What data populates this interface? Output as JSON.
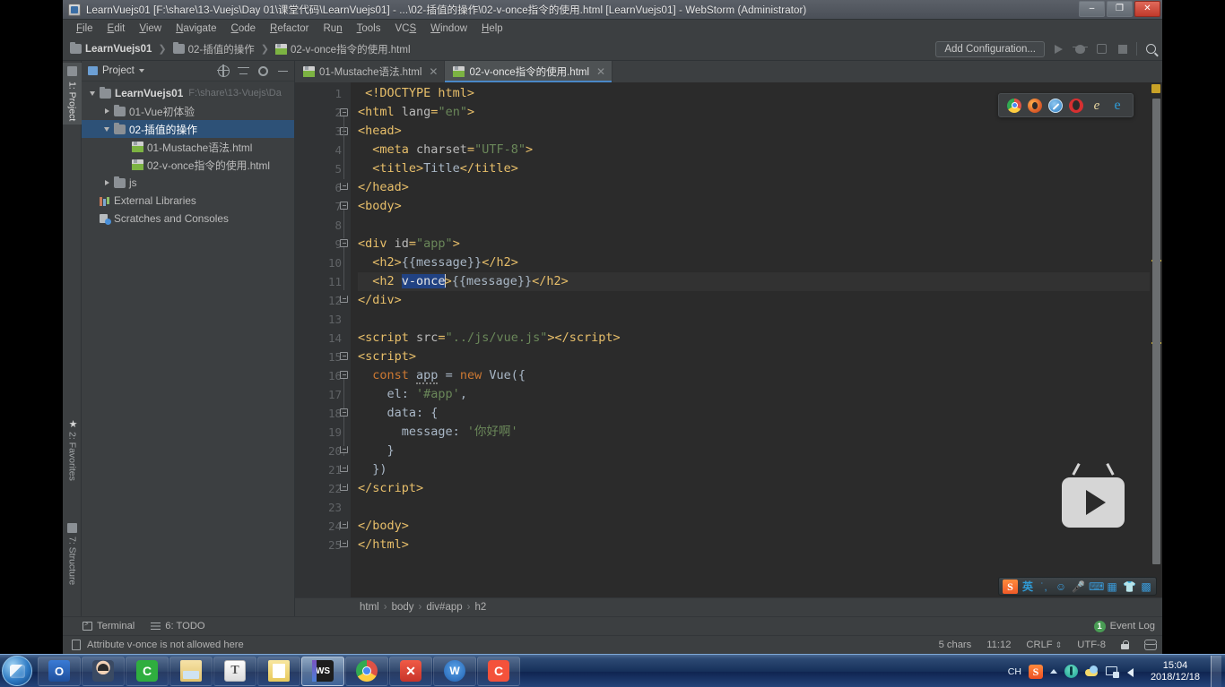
{
  "window": {
    "title": "LearnVuejs01 [F:\\share\\13-Vuejs\\Day 01\\课堂代码\\LearnVuejs01] - ...\\02-插值的操作\\02-v-once指令的使用.html [LearnVuejs01] - WebStorm (Administrator)",
    "icon": "webstorm-icon",
    "minimize": "–",
    "maximize": "❐",
    "close": "✕"
  },
  "menubar": {
    "items": [
      {
        "label": "File"
      },
      {
        "label": "Edit"
      },
      {
        "label": "View"
      },
      {
        "label": "Navigate"
      },
      {
        "label": "Code"
      },
      {
        "label": "Refactor"
      },
      {
        "label": "Run"
      },
      {
        "label": "Tools"
      },
      {
        "label": "VCS"
      },
      {
        "label": "Window"
      },
      {
        "label": "Help"
      }
    ]
  },
  "navbar": {
    "breadcrumb": [
      {
        "label": "LearnVuejs01",
        "icon": "folder-icon"
      },
      {
        "label": "02-插值的操作",
        "icon": "folder-icon"
      },
      {
        "label": "02-v-once指令的使用.html",
        "icon": "html-file-icon"
      }
    ],
    "add_configuration": "Add Configuration...",
    "run_icon": "run-icon",
    "debug_icon": "debug-icon",
    "run_with_coverage_icon": "run-with-coverage-icon",
    "stop_icon": "stop-icon",
    "search_icon": "search-icon"
  },
  "left_strip": {
    "project": "1: Project",
    "favorites": "2: Favorites",
    "structure": "7: Structure"
  },
  "project_panel": {
    "title": "Project",
    "header_icons": [
      "target-icon",
      "collapse-all-icon",
      "gear-icon",
      "minimize-icon"
    ],
    "tree": [
      {
        "label": "LearnVuejs01",
        "path": "F:\\share\\13-Vuejs\\Da",
        "indent": 0,
        "arrow": "down",
        "icon": "folder-icon",
        "bold": true,
        "selected": false
      },
      {
        "label": "01-Vue初体验",
        "path": "",
        "indent": 1,
        "arrow": "right",
        "icon": "folder-icon",
        "bold": false,
        "selected": false
      },
      {
        "label": "02-插值的操作",
        "path": "",
        "indent": 1,
        "arrow": "down",
        "icon": "folder-icon",
        "bold": false,
        "selected": true
      },
      {
        "label": "01-Mustache语法.html",
        "path": "",
        "indent": 2,
        "arrow": "none",
        "icon": "html-file-icon",
        "bold": false,
        "selected": false
      },
      {
        "label": "02-v-once指令的使用.html",
        "path": "",
        "indent": 2,
        "arrow": "none",
        "icon": "html-file-icon",
        "bold": false,
        "selected": false
      },
      {
        "label": "js",
        "path": "",
        "indent": 1,
        "arrow": "right",
        "icon": "folder-icon",
        "bold": false,
        "selected": false
      },
      {
        "label": "External Libraries",
        "path": "",
        "indent": 0,
        "arrow": "none",
        "icon": "library-icon",
        "bold": false,
        "selected": false
      },
      {
        "label": "Scratches and Consoles",
        "path": "",
        "indent": 0,
        "arrow": "none",
        "icon": "scratches-icon",
        "bold": false,
        "selected": false
      }
    ]
  },
  "editor": {
    "tabs": [
      {
        "label": "01-Mustache语法.html",
        "icon": "html-file-icon",
        "active": false,
        "close": "✕"
      },
      {
        "label": "02-v-once指令的使用.html",
        "icon": "html-file-icon",
        "active": true,
        "close": "✕"
      }
    ],
    "line_numbers": [
      "1",
      "2",
      "3",
      "4",
      "5",
      "6",
      "7",
      "8",
      "9",
      "10",
      "11",
      "12",
      "13",
      "14",
      "15",
      "16",
      "17",
      "18",
      "19",
      "20",
      "21",
      "22",
      "23",
      "24",
      "25"
    ],
    "lines": [
      {
        "n": 1,
        "text": "<!DOCTYPE html>"
      },
      {
        "n": 2,
        "text": "<html lang=\"en\">"
      },
      {
        "n": 3,
        "text": "<head>"
      },
      {
        "n": 4,
        "text": "  <meta charset=\"UTF-8\">"
      },
      {
        "n": 5,
        "text": "  <title>Title</title>"
      },
      {
        "n": 6,
        "text": "</head>"
      },
      {
        "n": 7,
        "text": "<body>"
      },
      {
        "n": 8,
        "text": ""
      },
      {
        "n": 9,
        "text": "<div id=\"app\">"
      },
      {
        "n": 10,
        "text": "  <h2>{{message}}</h2>"
      },
      {
        "n": 11,
        "text": "  <h2 v-once>{{message}}</h2>"
      },
      {
        "n": 12,
        "text": "</div>"
      },
      {
        "n": 13,
        "text": ""
      },
      {
        "n": 14,
        "text": "<script src=\"../js/vue.js\"></script>"
      },
      {
        "n": 15,
        "text": "<script>"
      },
      {
        "n": 16,
        "text": "  const app = new Vue({"
      },
      {
        "n": 17,
        "text": "    el: '#app',"
      },
      {
        "n": 18,
        "text": "    data: {"
      },
      {
        "n": 19,
        "text": "      message: '你好啊'"
      },
      {
        "n": 20,
        "text": "    }"
      },
      {
        "n": 21,
        "text": "  })"
      },
      {
        "n": 22,
        "text": "</script>"
      },
      {
        "n": 23,
        "text": ""
      },
      {
        "n": 24,
        "text": "</body>"
      },
      {
        "n": 25,
        "text": "</html>"
      }
    ],
    "selection": "v-once",
    "current_line": 11,
    "browser_popup": [
      {
        "name": "chrome-icon"
      },
      {
        "name": "firefox-icon"
      },
      {
        "name": "safari-icon"
      },
      {
        "name": "opera-icon"
      },
      {
        "name": "internet-explorer-icon"
      },
      {
        "name": "edge-icon"
      }
    ],
    "breadcrumb": [
      "html",
      "body",
      "div#app",
      "h2"
    ]
  },
  "toolwindow_bar": {
    "terminal": "Terminal",
    "todo": "6: TODO",
    "event_log": "Event Log",
    "event_count": "1"
  },
  "statusbar": {
    "message": "Attribute v-once is not allowed here",
    "chars": "5 chars",
    "caret": "11:12",
    "line_separator": "CRLF",
    "encoding": "UTF-8",
    "lock_icon": "lock-icon",
    "database_icon": "database-icon"
  },
  "ime": {
    "logo": "S",
    "mode": "英",
    "icons": [
      "voice-icon",
      "emoji-icon",
      "keyboard-icon",
      "screenshot-icon",
      "skin-icon",
      "toolbox-icon"
    ]
  },
  "taskbar": {
    "start": "start-orb",
    "items": [
      {
        "name": "outlook-icon",
        "active": false
      },
      {
        "name": "qq-person-icon",
        "active": false
      },
      {
        "name": "camtasia-icon",
        "active": false
      },
      {
        "name": "explorer-icon",
        "active": false
      },
      {
        "name": "typora-icon",
        "active": false
      },
      {
        "name": "notes-icon",
        "active": false
      },
      {
        "name": "webstorm-icon",
        "active": true
      },
      {
        "name": "chrome-icon",
        "active": false
      },
      {
        "name": "xmind-icon",
        "active": false
      },
      {
        "name": "wps-icon",
        "active": false
      },
      {
        "name": "camtasia2-icon",
        "active": false
      }
    ],
    "tray": {
      "ime_label": "CH",
      "sogou": "S",
      "time": "15:04",
      "date": "2018/12/18"
    }
  },
  "colors": {
    "editor_bg": "#2b2b2b",
    "gutter_bg": "#313335",
    "panel_bg": "#3c3f41",
    "selection": "#214283",
    "tree_selection": "#2d5177",
    "tag": "#e8bf6a",
    "string": "#6a8759",
    "keyword": "#cc7832",
    "accent": "#4a88c7"
  }
}
